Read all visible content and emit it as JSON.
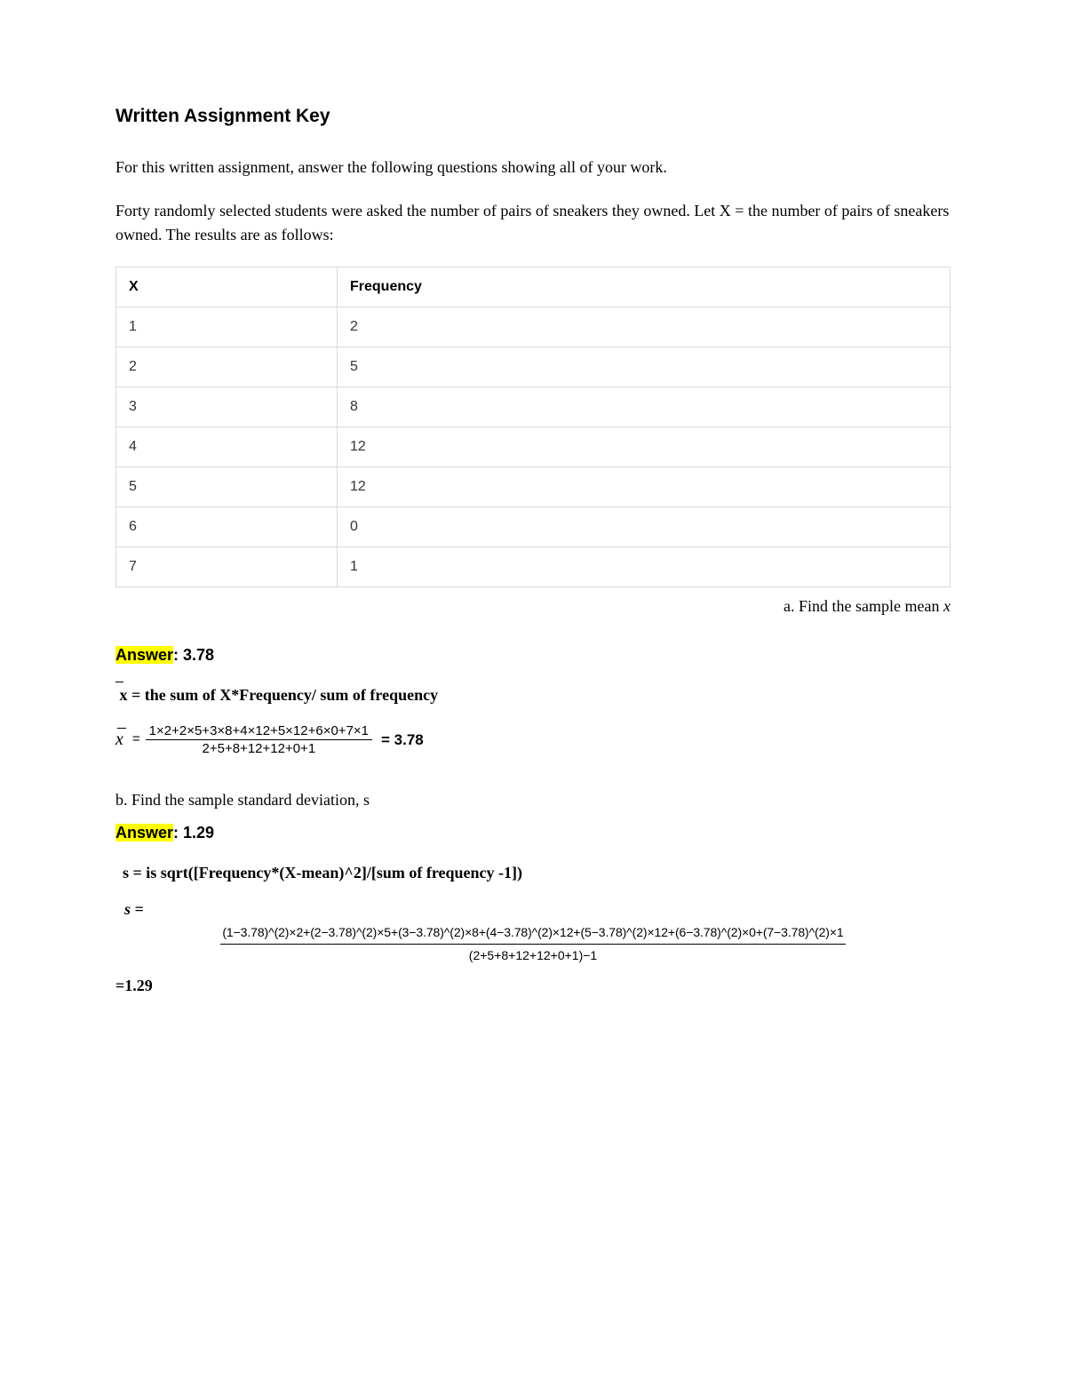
{
  "title": "Written Assignment Key",
  "intro": "For this written assignment, answer the following questions showing all of your work.",
  "prompt": "Forty randomly selected students were asked the number of pairs of sneakers they owned. Let X = the number of pairs of sneakers owned. The results are as follows:",
  "table": {
    "headers": {
      "x": "X",
      "freq": "Frequency"
    },
    "rows": [
      {
        "x": "1",
        "freq": "2"
      },
      {
        "x": "2",
        "freq": "5"
      },
      {
        "x": "3",
        "freq": "8"
      },
      {
        "x": "4",
        "freq": "12"
      },
      {
        "x": "5",
        "freq": "12"
      },
      {
        "x": "6",
        "freq": "0"
      },
      {
        "x": "7",
        "freq": "1"
      }
    ]
  },
  "question_a_prefix": "a. Find the sample mean ",
  "question_a_var": "x",
  "answer_label": "Answer",
  "answer_a_value": ": 3.78",
  "mean_def_prefix": "x  = the sum of X*Frequency/ sum of frequency",
  "mean_formula": {
    "lhs": "x",
    "num": "1×2+2×5+3×8+4×12+5×12+6×0+7×1",
    "den": "2+5+8+12+12+0+1",
    "result": "= 3.78"
  },
  "question_b": "b. Find the sample standard deviation, s",
  "answer_b_value": ": 1.29",
  "s_def": "s = is sqrt([Frequency*(X-mean)^2]/[sum of frequency -1])",
  "s_formula": {
    "lhs": "s =",
    "num": "(1−3.78)^(2)×2+(2−3.78)^(2)×5+(3−3.78)^(2)×8+(4−3.78)^(2)×12+(5−3.78)^(2)×12+(6−3.78)^(2)×0+(7−3.78)^(2)×1",
    "den": "(2+5+8+12+12+0+1)−1",
    "result": "=1.29"
  }
}
